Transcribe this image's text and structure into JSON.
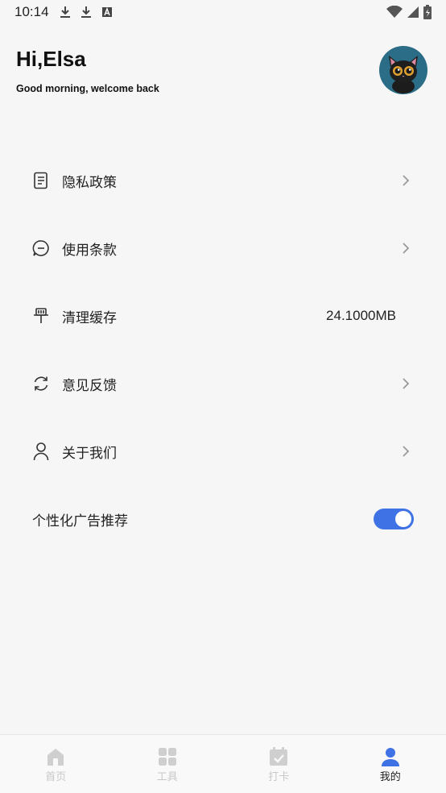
{
  "status_bar": {
    "time": "10:14",
    "left_icons": [
      "download-icon",
      "download-icon",
      "text-a-icon"
    ],
    "right_icons": [
      "wifi-icon",
      "signal-icon",
      "battery-icon"
    ]
  },
  "header": {
    "title": "Hi,Elsa",
    "subtitle": "Good morning, welcome back",
    "avatar_icon": "cat-avatar-icon"
  },
  "menu": {
    "items": [
      {
        "label": "隐私政策",
        "icon": "document-icon",
        "chevron": true
      },
      {
        "label": "使用条款",
        "icon": "chat-bubble-icon",
        "chevron": true
      },
      {
        "label": "清理缓存",
        "icon": "broom-icon",
        "value": "24.1000MB"
      },
      {
        "label": "意见反馈",
        "icon": "refresh-icon",
        "chevron": true
      },
      {
        "label": "关于我们",
        "icon": "user-icon",
        "chevron": true
      }
    ],
    "toggle": {
      "label": "个性化广告推荐",
      "enabled": true
    }
  },
  "tabbar": {
    "tabs": [
      {
        "label": "首页",
        "icon": "home-icon",
        "active": false
      },
      {
        "label": "工具",
        "icon": "grid-icon",
        "active": false
      },
      {
        "label": "打卡",
        "icon": "calendar-check-icon",
        "active": false
      },
      {
        "label": "我的",
        "icon": "profile-icon",
        "active": true
      }
    ]
  },
  "colors": {
    "accent": "#3f72e5",
    "background": "#f6f6f6",
    "tab_inactive": "#c8c8c8",
    "avatar_bg": "#2b6c86"
  }
}
